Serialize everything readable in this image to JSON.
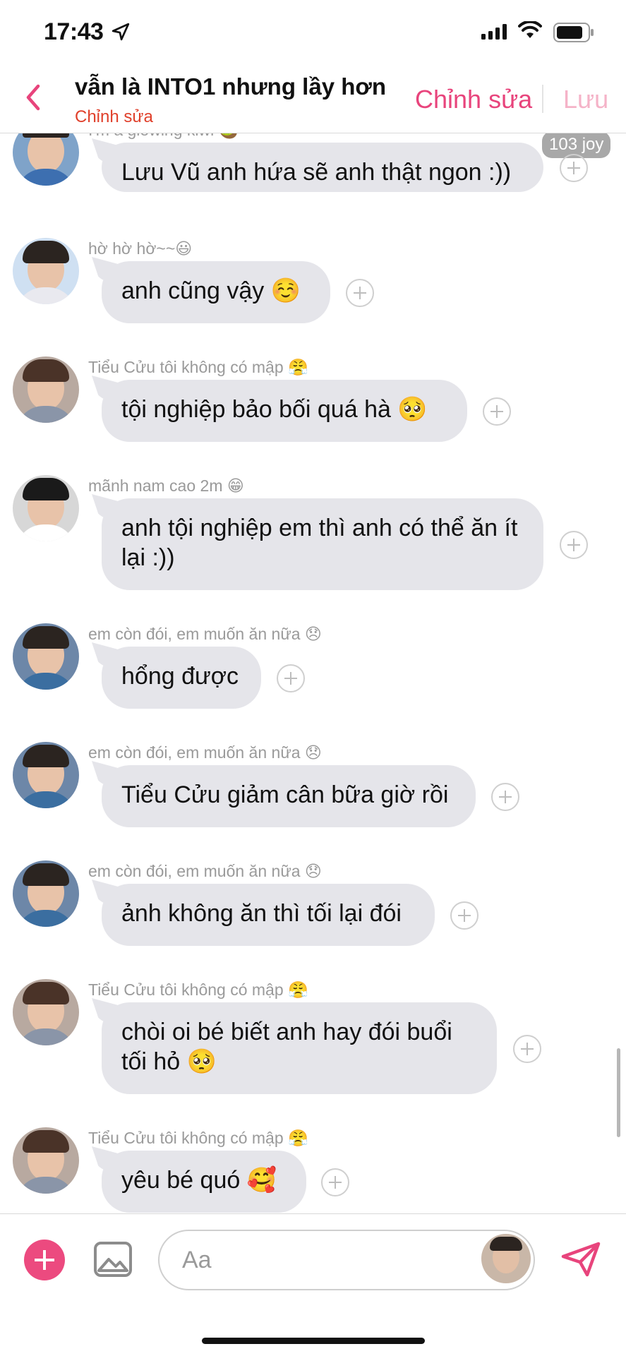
{
  "status_bar": {
    "time": "17:43",
    "icons": [
      "location-arrow-icon",
      "signal-icon",
      "wifi-icon",
      "battery-icon"
    ]
  },
  "header": {
    "title": "vẫn là INTO1 nhưng lầy hơn",
    "subtitle": "Chỉnh sửa",
    "edit_label": "Chỉnh sửa",
    "save_label": "Lưu",
    "accent_color": "#e8447c"
  },
  "messages": [
    {
      "sender": "I'm a glowing kiwi 🥝",
      "text": "Lưu Vũ anh hứa sẽ anh thật ngon :))",
      "badge": "103 joy"
    },
    {
      "sender": "hờ hờ hờ~~😃",
      "text": "anh cũng vậy ☺️"
    },
    {
      "sender": "Tiểu Cửu tôi không có mập 😤",
      "text": "tội nghiệp bảo bối quá hà 🥺"
    },
    {
      "sender": "mãnh nam cao 2m 😁",
      "text": "anh tội nghiệp em thì anh có thể ăn ít lại :))"
    },
    {
      "sender": "em còn đói, em muốn ăn nữa 😞",
      "text": "hổng được"
    },
    {
      "sender": "em còn đói, em muốn ăn nữa 😞",
      "text": "Tiểu Cửu giảm cân bữa giờ rồi"
    },
    {
      "sender": "em còn đói, em muốn ăn nữa 😞",
      "text": "ảnh không ăn thì tối lại đói"
    },
    {
      "sender": "Tiểu Cửu tôi không có mập 😤",
      "text": "chòi oi bé biết anh hay đói buổi tối hỏ 🥺"
    },
    {
      "sender": "Tiểu Cửu tôi không có mập 😤",
      "text": "yêu bé quó 🥰"
    }
  ],
  "composer": {
    "placeholder": "Aa",
    "plus_color": "#ec4a7f"
  },
  "colors": {
    "bubble": "#e5e5ea",
    "sender_text": "#9a9a9a",
    "subtitle": "#e0402b"
  }
}
